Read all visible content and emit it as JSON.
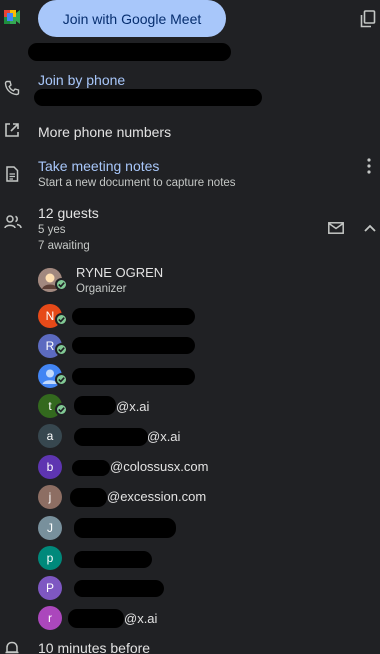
{
  "meet": {
    "button_label": "Join with Google Meet"
  },
  "phone": {
    "join_label": "Join by phone"
  },
  "more_numbers": {
    "label": "More phone numbers"
  },
  "notes": {
    "title": "Take meeting notes",
    "subtitle": "Start a new document to capture notes"
  },
  "guests": {
    "count_label": "12 guests",
    "yes_label": "5 yes",
    "awaiting_label": "7 awaiting",
    "list": [
      {
        "initial": "",
        "name": "RYNE OGREN",
        "role": "Organizer",
        "color": "#8d6e63",
        "accepted": true
      },
      {
        "initial": "N",
        "suffix": "",
        "color": "#e64a19",
        "accepted": true
      },
      {
        "initial": "R",
        "suffix": "",
        "color": "#5c6bc0",
        "accepted": true
      },
      {
        "initial": "",
        "suffix": "",
        "color": "#4285f4",
        "accepted": true
      },
      {
        "initial": "t",
        "suffix": "@x.ai",
        "color": "#33691e",
        "accepted": true
      },
      {
        "initial": "a",
        "suffix": "@x.ai",
        "color": "#37474f",
        "accepted": false
      },
      {
        "initial": "b",
        "suffix": "@colossusx.com",
        "color": "#5e35b1",
        "accepted": false
      },
      {
        "initial": "j",
        "suffix": "@excession.com",
        "color": "#8d6e63",
        "accepted": false
      },
      {
        "initial": "J",
        "suffix": "",
        "color": "#78909c",
        "accepted": false
      },
      {
        "initial": "p",
        "suffix": "",
        "color": "#00897b",
        "accepted": false
      },
      {
        "initial": "P",
        "suffix": "",
        "color": "#7e57c2",
        "accepted": false
      },
      {
        "initial": "r",
        "suffix": "@x.ai",
        "color": "#ab47bc",
        "accepted": false
      }
    ]
  },
  "reminder": {
    "label": "10 minutes before"
  },
  "colors": {
    "accent": "#a8c7fa",
    "background": "#202124",
    "check": "#81c995"
  }
}
